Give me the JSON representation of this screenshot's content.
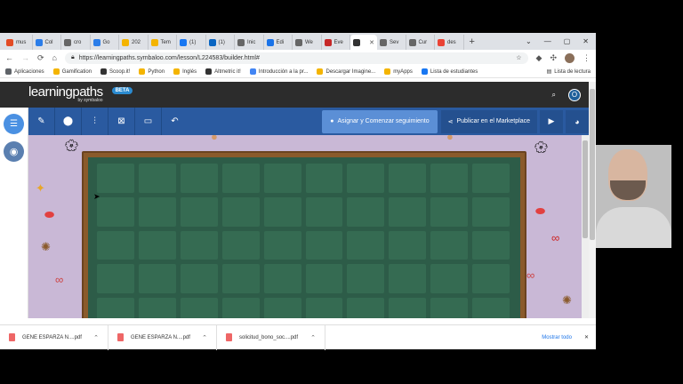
{
  "browser": {
    "tabs": [
      {
        "label": "mus",
        "color": "#e34c26"
      },
      {
        "label": "Col",
        "color": "#2b7de9"
      },
      {
        "label": "cro",
        "color": "#666666"
      },
      {
        "label": "Go",
        "color": "#2b7de9"
      },
      {
        "label": "202",
        "color": "#f4b400"
      },
      {
        "label": "Tem",
        "color": "#f4b400"
      },
      {
        "label": "(1)",
        "color": "#1877f2"
      },
      {
        "label": "(1)",
        "color": "#0a66c2"
      },
      {
        "label": "Inic",
        "color": "#666666"
      },
      {
        "label": "Edi",
        "color": "#1a73e8"
      },
      {
        "label": "We",
        "color": "#666666"
      },
      {
        "label": "Eve",
        "color": "#c62828"
      },
      {
        "label": "",
        "color": "#333333"
      },
      {
        "label": "Sev",
        "color": "#666666"
      },
      {
        "label": "Cur",
        "color": "#666666"
      },
      {
        "label": "des",
        "color": "#ea4335"
      }
    ],
    "url": "https://learningpaths.symbaloo.com/lesson/L224583/builder.html#",
    "bookmarks": [
      {
        "label": "Aplicaciones",
        "color": "#5f6368"
      },
      {
        "label": "Gamification",
        "color": "#f4b400"
      },
      {
        "label": "Scoop.it!",
        "color": "#333333"
      },
      {
        "label": "Python",
        "color": "#f4b400"
      },
      {
        "label": "Inglés",
        "color": "#f4b400"
      },
      {
        "label": "Altmetric it!",
        "color": "#333333"
      },
      {
        "label": "Introducción a la pr...",
        "color": "#4285f4"
      },
      {
        "label": "Descargar Imagine...",
        "color": "#f4b400"
      },
      {
        "label": "myApps",
        "color": "#f4b400"
      },
      {
        "label": "Lista de estudiantes",
        "color": "#1877f2"
      }
    ],
    "bookmarks_other": "Lista de lectura"
  },
  "app": {
    "logo": "learningpaths",
    "logo_sub": "by symbaloo",
    "beta": "BETA",
    "avatar": "O"
  },
  "toolbar": {
    "assign_label": "Asignar y Comenzar seguimiento",
    "publish_label": "Publicar en el Marketplace"
  },
  "downloads": [
    {
      "name": "GENE ESPARZA N....pdf"
    },
    {
      "name": "GENE ESPARZA N....pdf"
    },
    {
      "name": "solicitud_bono_soc....pdf"
    }
  ],
  "downloads_show_all": "Mostrar todo",
  "colors": {
    "header": "#2c2c2c",
    "toolbar": "#2a5aa0",
    "board": "#2d5c48",
    "frame": "#8a5a2b",
    "canvas": "#c9b8d6"
  }
}
